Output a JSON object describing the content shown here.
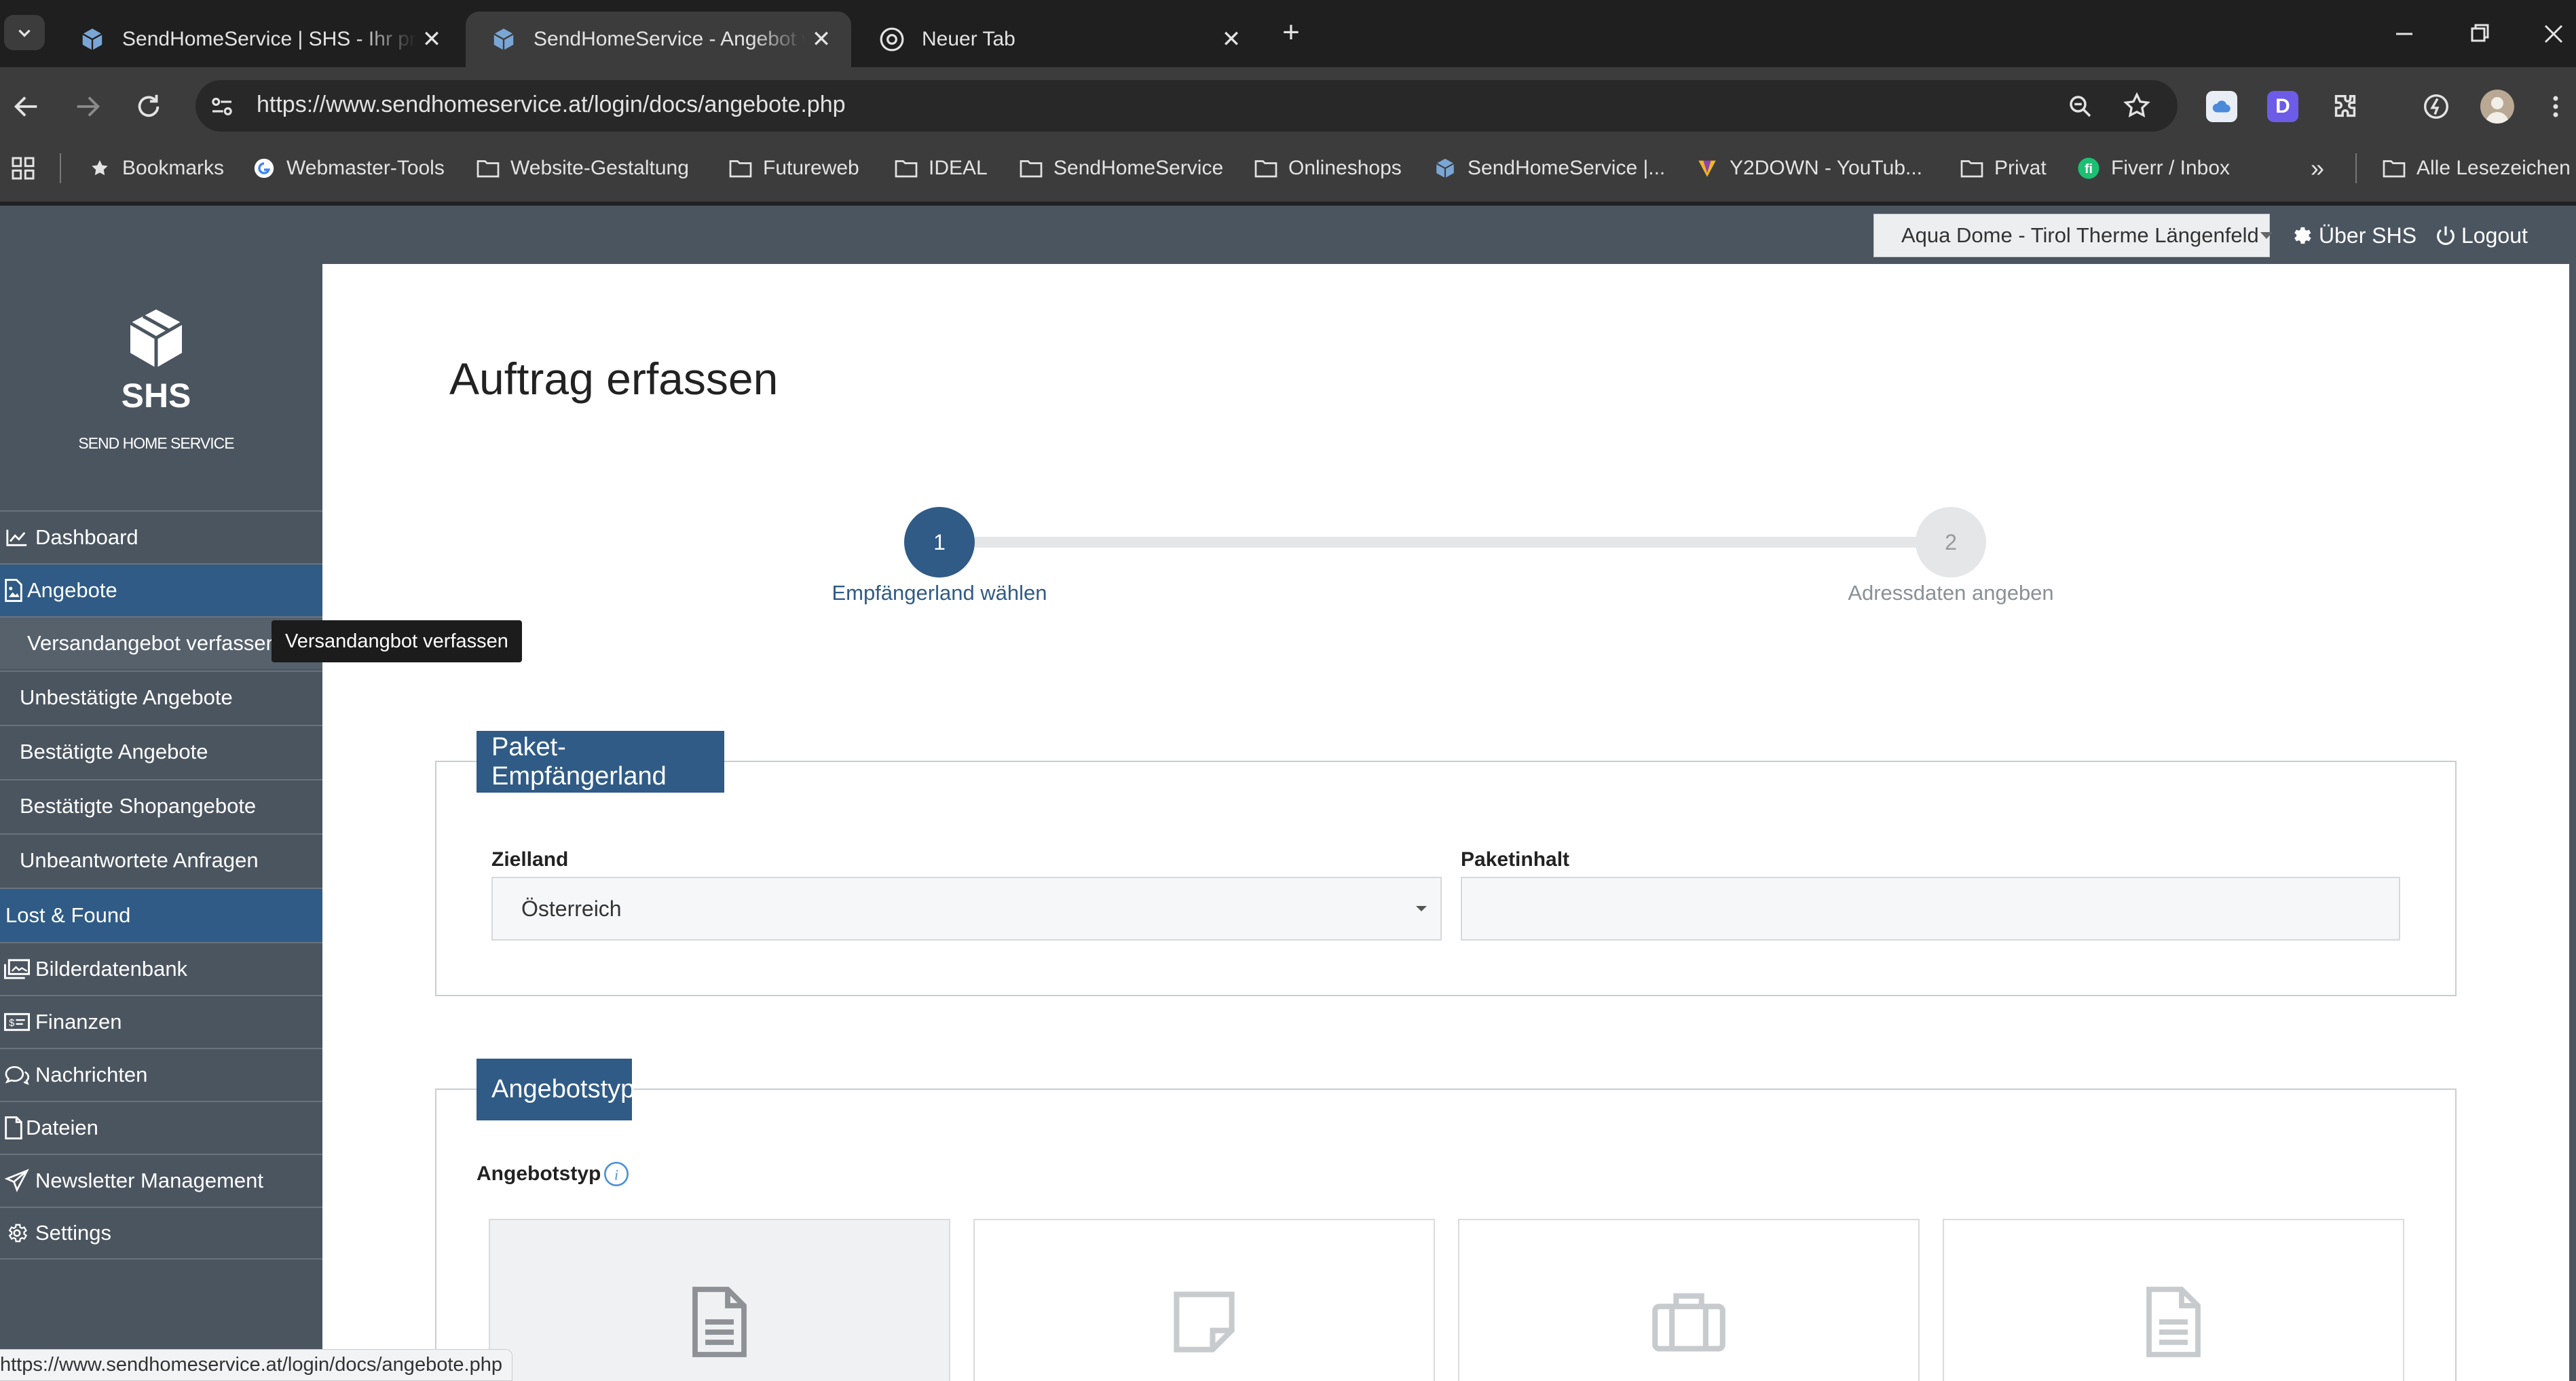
{
  "browser": {
    "tabs": [
      {
        "title": "SendHomeService | SHS - Ihr pr",
        "active": false
      },
      {
        "title": "SendHomeService - Angebot ve",
        "active": true
      },
      {
        "title": "Neuer Tab",
        "active": false
      }
    ],
    "url": "https://www.sendhomeservice.at/login/docs/angebote.php",
    "bookmarks": [
      "Bookmarks",
      "Webmaster-Tools",
      "Website-Gestaltung",
      "Futureweb",
      "IDEAL",
      "SendHomeService",
      "Onlineshops",
      "SendHomeService |...",
      "Y2DOWN - YouTub...",
      "Privat",
      "Fiverr / Inbox"
    ],
    "other_bookmarks": "Alle Lesezeichen",
    "status_url": "https://www.sendhomeservice.at/login/docs/angebote.php"
  },
  "topbar": {
    "location_select": "Aqua Dome - Tirol Therme Längenfeld",
    "about": "Über SHS",
    "logout": "Logout"
  },
  "logo": {
    "abbr": "SHS",
    "tagline": "SEND HOME SERVICE"
  },
  "sidebar": {
    "items": [
      {
        "label": "Dashboard",
        "icon": "line-chart-icon"
      },
      {
        "label": "Angebote",
        "icon": "document-image-icon"
      },
      {
        "label": "Lost & Found",
        "icon": ""
      },
      {
        "label": "Bilderdatenbank",
        "icon": "images-icon"
      },
      {
        "label": "Finanzen",
        "icon": "money-icon"
      },
      {
        "label": "Nachrichten",
        "icon": "comments-icon"
      },
      {
        "label": "Dateien",
        "icon": "file-icon"
      },
      {
        "label": "Newsletter Management",
        "icon": "paper-plane-icon"
      },
      {
        "label": "Settings",
        "icon": "gear-icon"
      }
    ],
    "sub_items": [
      "Versandangebot verfassen",
      "Unbestätigte Angebote",
      "Bestätigte Angebote",
      "Bestätigte Shopangebote",
      "Unbeantwortete Anfragen"
    ],
    "tooltip": "Versandangbot verfassen"
  },
  "main": {
    "title": "Auftrag erfassen",
    "steps": [
      {
        "number": "1",
        "label": "Empfängerland wählen",
        "active": true
      },
      {
        "number": "2",
        "label": "Adressdaten angeben",
        "active": false
      }
    ],
    "panel_country": {
      "title": "Paket-Empfängerland",
      "destination_label": "Zielland",
      "destination_value": "Österreich",
      "content_label": "Paketinhalt",
      "content_value": ""
    },
    "panel_type": {
      "title": "Angebotstyp",
      "field_label": "Angebotstyp",
      "cards": [
        {
          "icon": "document-lines-icon"
        },
        {
          "icon": "sticky-note-icon"
        },
        {
          "icon": "briefcase-icon"
        },
        {
          "icon": "document-lines-icon"
        }
      ]
    }
  },
  "colors": {
    "nav_bg": "#4b5560",
    "accent_blue": "#2f5b86",
    "step_inactive": "#e4e6e8",
    "chrome_dark": "#1f1f1f",
    "chrome_toolbar": "#3c3c3c"
  }
}
